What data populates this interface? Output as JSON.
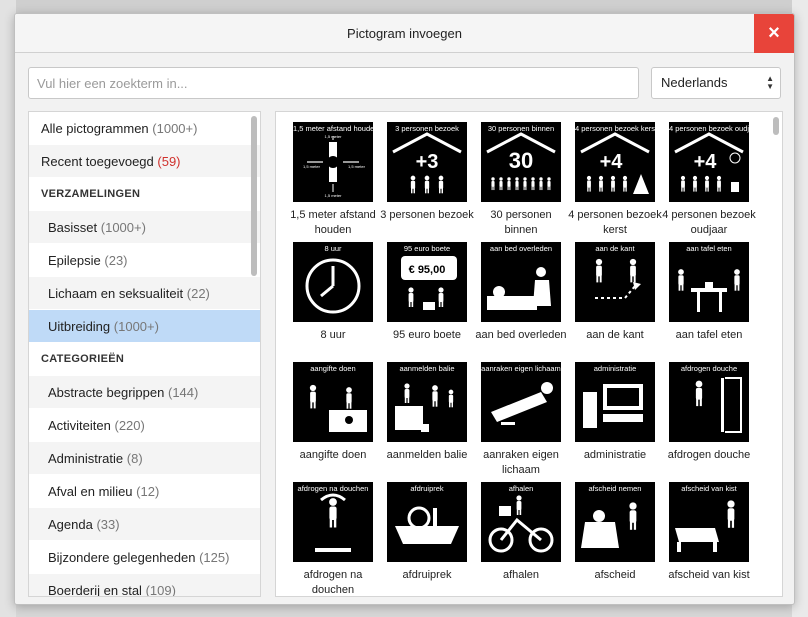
{
  "dialog": {
    "title": "Pictogram invoegen",
    "close_icon": "×"
  },
  "search": {
    "placeholder": "Vul hier een zoekterm in...",
    "value": ""
  },
  "language": {
    "selected": "Nederlands"
  },
  "sidebar": {
    "top_items": [
      {
        "label": "Alle pictogrammen",
        "count": "(1000+)"
      },
      {
        "label": "Recent toegevoegd",
        "count": "(59)"
      }
    ],
    "collections_heading": "VERZAMELINGEN",
    "collections": [
      {
        "label": "Basisset",
        "count": "(1000+)"
      },
      {
        "label": "Epilepsie",
        "count": "(23)"
      },
      {
        "label": "Lichaam en seksualiteit",
        "count": "(22)"
      },
      {
        "label": "Uitbreiding",
        "count": "(1000+)"
      }
    ],
    "categories_heading": "CATEGORIEËN",
    "categories": [
      {
        "label": "Abstracte begrippen",
        "count": "(144)"
      },
      {
        "label": "Activiteiten",
        "count": "(220)"
      },
      {
        "label": "Administratie",
        "count": "(8)"
      },
      {
        "label": "Afval en milieu",
        "count": "(12)"
      },
      {
        "label": "Agenda",
        "count": "(33)"
      },
      {
        "label": "Bijzondere gelegenheden",
        "count": "(125)"
      },
      {
        "label": "Boerderij en stal",
        "count": "(109)"
      }
    ]
  },
  "pictograms": [
    {
      "caption": "1,5 meter afstand houden",
      "label": "1,5 meter afstand houden",
      "icon": "distance-icon",
      "extra": [
        "1,5 meter",
        "1,5 meter",
        "1,5 meter",
        "1,5 meter"
      ]
    },
    {
      "caption": "3 personen bezoek",
      "label": "3 personen bezoek",
      "icon": "visitors-3-icon",
      "extra": [
        "+3"
      ]
    },
    {
      "caption": "30 personen binnen",
      "label": "30 personen binnen",
      "icon": "visitors-30-icon",
      "extra": [
        "30"
      ]
    },
    {
      "caption": "4 personen bezoek kerst",
      "label": "4 personen bezoek kerst",
      "icon": "visitors-christmas-icon",
      "extra": [
        "+4"
      ]
    },
    {
      "caption": "4 personen bezoek oudjaar",
      "label": "4 personen bezoek oudjaar",
      "icon": "visitors-newyear-icon",
      "extra": [
        "+4"
      ]
    },
    {
      "caption": "8 uur",
      "label": "8 uur",
      "icon": "clock-icon"
    },
    {
      "caption": "95 euro boete",
      "label": "95 euro boete",
      "icon": "fine-icon",
      "extra": [
        "€ 95,00"
      ]
    },
    {
      "caption": "aan bed overleden",
      "label": "aan bed overleden",
      "icon": "deathbed-icon"
    },
    {
      "caption": "aan de kant",
      "label": "aan de kant",
      "icon": "step-aside-icon"
    },
    {
      "caption": "aan tafel eten",
      "label": "aan tafel eten",
      "icon": "table-eating-icon"
    },
    {
      "caption": "aangifte doen",
      "label": "aangifte doen",
      "icon": "police-report-icon"
    },
    {
      "caption": "aanmelden balie",
      "label": "aanmelden balie",
      "icon": "reception-desk-icon"
    },
    {
      "caption": "aanraken eigen lichaam",
      "label": "aanraken eigen lichaam",
      "icon": "touch-body-icon"
    },
    {
      "caption": "administratie",
      "label": "administratie",
      "icon": "administration-icon"
    },
    {
      "caption": "afdrogen douche",
      "label": "afdrogen douche",
      "icon": "towel-shower-icon"
    },
    {
      "caption": "afdrogen na douchen",
      "label": "afdrogen na douchen",
      "icon": "towel-after-shower-icon"
    },
    {
      "caption": "afdruiprek",
      "label": "afdruiprek",
      "icon": "dish-rack-icon"
    },
    {
      "caption": "afhalen",
      "label": "afhalen",
      "icon": "delivery-bike-icon"
    },
    {
      "caption": "afscheid nemen",
      "label": "afscheid",
      "icon": "farewell-icon"
    },
    {
      "caption": "afscheid van kist",
      "label": "afscheid van kist",
      "icon": "coffin-farewell-icon"
    }
  ]
}
